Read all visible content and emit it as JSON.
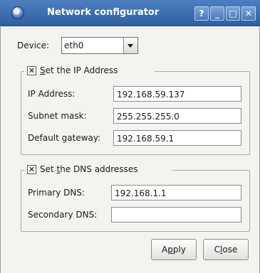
{
  "window": {
    "title": "Network configurator",
    "help_label": "?",
    "minimize_label": "_",
    "maximize_label": "□",
    "close_label": "✕"
  },
  "device": {
    "label": "Device:",
    "selected": "eth0"
  },
  "ip_group": {
    "checkbox_checked": true,
    "legend_prefix": "",
    "legend_mnemonic": "S",
    "legend_rest": "et the IP Address",
    "ip_label": "IP Address:",
    "ip_value": "192.168.59.137",
    "mask_label": "Subnet mask:",
    "mask_value": "255.255.255.0",
    "gateway_label": "Default gateway:",
    "gateway_value": "192.168.59.1"
  },
  "dns_group": {
    "checkbox_checked": true,
    "legend_prefix": "Set ",
    "legend_mnemonic": "t",
    "legend_rest": "he DNS addresses",
    "primary_label": "Primary DNS:",
    "primary_value": "192.168.1.1",
    "secondary_label": "Secondary DNS:",
    "secondary_value": ""
  },
  "buttons": {
    "apply_prefix": "A",
    "apply_mnemonic": "p",
    "apply_rest": "ply",
    "close_prefix": "C",
    "close_mnemonic": "l",
    "close_rest": "ose"
  },
  "colors": {
    "titlebar": "#3a6aae",
    "background": "#f4f3ef"
  }
}
